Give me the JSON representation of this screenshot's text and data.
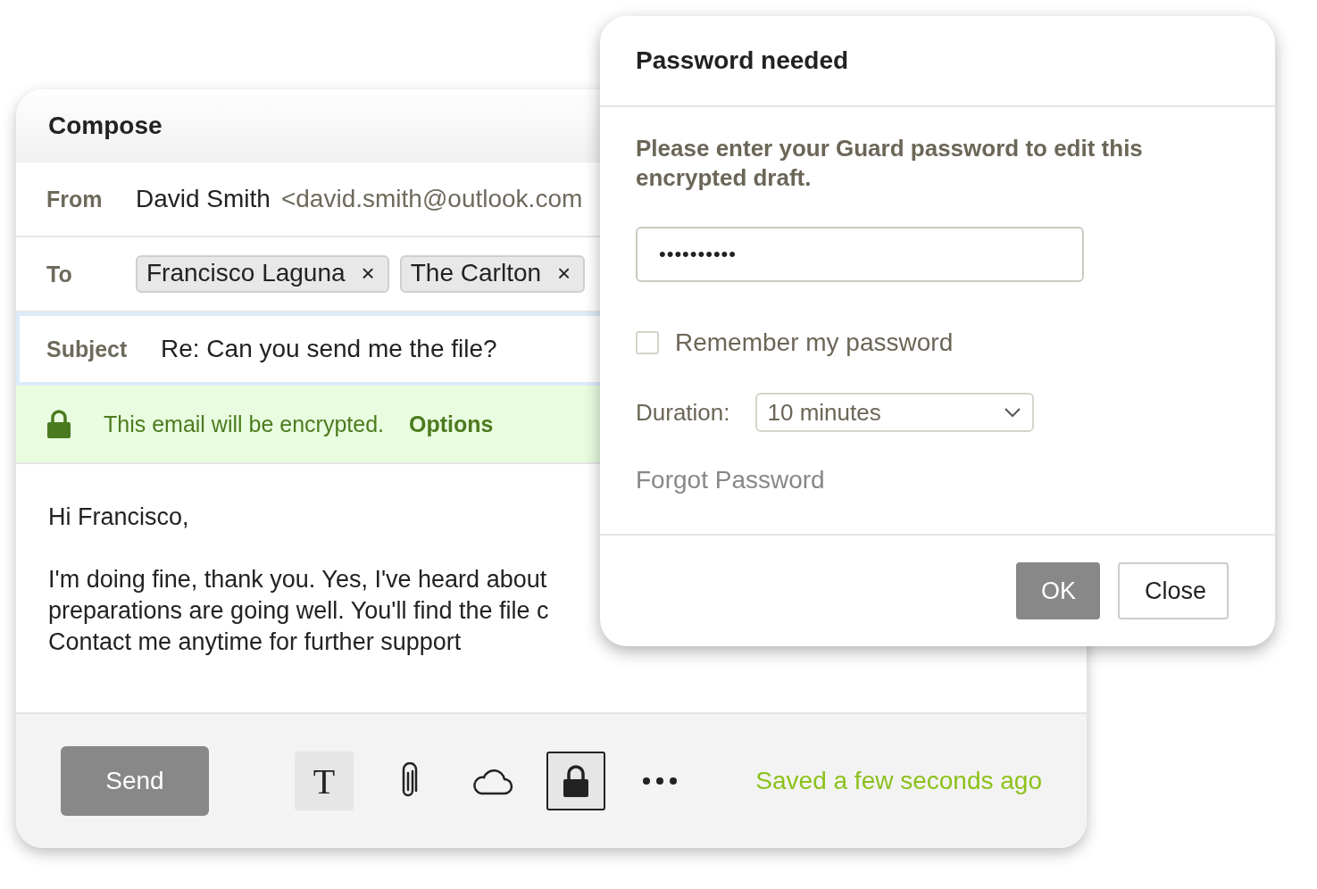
{
  "compose": {
    "title": "Compose",
    "from": {
      "label": "From",
      "name": "David Smith",
      "address": "<david.smith@outlook.com"
    },
    "to": {
      "label": "To",
      "recipients": [
        {
          "name": "Francisco Laguna",
          "remove": "×"
        },
        {
          "name": "The Carlton",
          "remove": "×"
        }
      ]
    },
    "subject": {
      "label": "Subject",
      "value": "Re: Can you send me the file?"
    },
    "encryption": {
      "message": "This email will be encrypted.",
      "link": "Options"
    },
    "body": {
      "greeting": "Hi Francisco,",
      "lines": [
        "I'm doing fine, thank you. Yes, I've heard about",
        "preparations are going well. You'll find the file c",
        "Contact me anytime for further support"
      ]
    },
    "footer": {
      "send": "Send",
      "tools": [
        {
          "kind": "text",
          "label": "T",
          "highlighted": true,
          "selected": false
        },
        {
          "kind": "attach",
          "highlighted": false,
          "selected": false
        },
        {
          "kind": "cloud",
          "highlighted": false,
          "selected": false
        },
        {
          "kind": "lock",
          "highlighted": true,
          "selected": true
        },
        {
          "kind": "more",
          "highlighted": false,
          "selected": false
        }
      ],
      "status": "Saved a few seconds ago"
    }
  },
  "dialog": {
    "title": "Password needed",
    "message": "Please enter your Guard password to edit this encrypted draft.",
    "password": "••••••••••",
    "remember": {
      "label": "Remember my password",
      "checked": false
    },
    "duration": {
      "label": "Duration:",
      "value": "10 minutes"
    },
    "forgot": "Forgot Password",
    "buttons": [
      {
        "label": "OK",
        "kind": "primary"
      },
      {
        "label": "Close",
        "kind": "secondary"
      }
    ]
  }
}
